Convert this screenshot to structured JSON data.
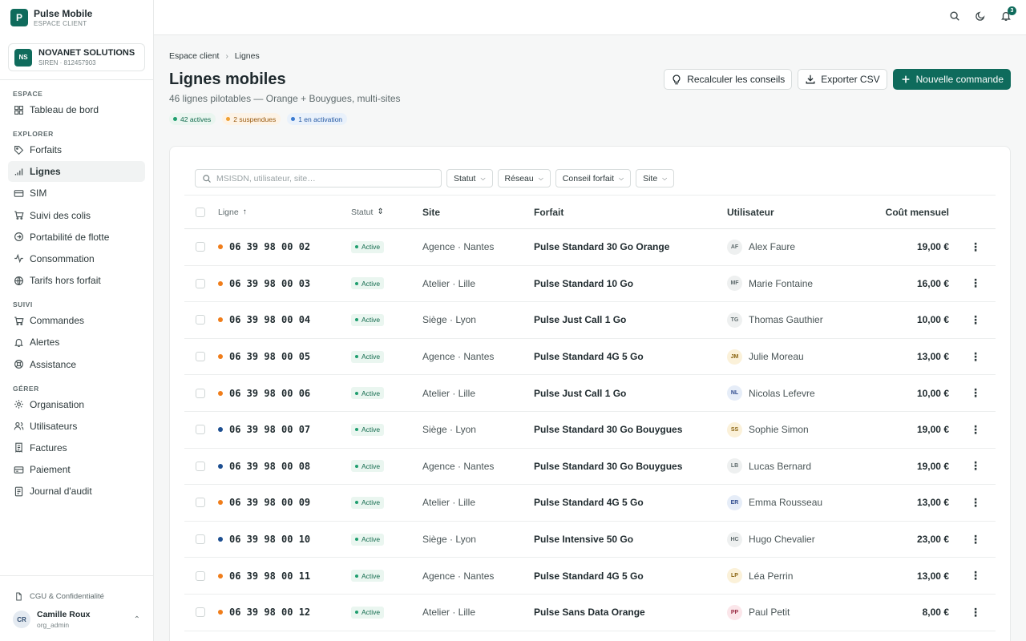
{
  "brand": {
    "logo": "P",
    "name": "Pulse Mobile",
    "sub": "ESPACE CLIENT"
  },
  "org": {
    "badge": "NS",
    "name": "NOVANET SOLUTIONS",
    "siren": "SIREN · 812457903"
  },
  "sidebar": {
    "sections": [
      {
        "label": "ESPACE",
        "items": [
          {
            "label": "Tableau de bord",
            "icon": "dashboard-icon"
          }
        ]
      },
      {
        "label": "EXPLORER",
        "items": [
          {
            "label": "Forfaits",
            "icon": "tag-icon"
          },
          {
            "label": "Lignes",
            "icon": "signal-icon",
            "active": true
          },
          {
            "label": "SIM",
            "icon": "card-icon"
          },
          {
            "label": "Suivi des colis",
            "icon": "truck-icon"
          },
          {
            "label": "Portabilité de flotte",
            "icon": "arrow-circle-icon"
          },
          {
            "label": "Consommation",
            "icon": "activity-icon"
          },
          {
            "label": "Tarifs hors forfait",
            "icon": "globe-icon"
          }
        ]
      },
      {
        "label": "SUIVI",
        "items": [
          {
            "label": "Commandes",
            "icon": "cart-icon"
          },
          {
            "label": "Alertes",
            "icon": "bell-icon"
          },
          {
            "label": "Assistance",
            "icon": "lifebuoy-icon"
          }
        ]
      },
      {
        "label": "GÉRER",
        "items": [
          {
            "label": "Organisation",
            "icon": "settings-icon"
          },
          {
            "label": "Utilisateurs",
            "icon": "users-icon"
          },
          {
            "label": "Factures",
            "icon": "receipt-icon"
          },
          {
            "label": "Paiement",
            "icon": "credit-card-icon"
          },
          {
            "label": "Journal d'audit",
            "icon": "audit-icon"
          }
        ]
      }
    ],
    "legal": "CGU & Confidentialité",
    "user": {
      "initials": "CR",
      "name": "Camille Roux",
      "role": "org_admin"
    }
  },
  "topbar": {
    "notif_count": "3"
  },
  "breadcrumb": {
    "root": "Espace client",
    "current": "Lignes"
  },
  "page": {
    "title": "Lignes mobiles",
    "subtitle": "46 lignes pilotables — Orange + Bouygues, multi-sites",
    "chips": {
      "active": "42 actives",
      "suspended": "2 suspendues",
      "activating": "1 en activation"
    }
  },
  "actions": {
    "recalc": "Recalculer les conseils",
    "export": "Exporter CSV",
    "new_order": "Nouvelle commande"
  },
  "filters": {
    "search_placeholder": "MSISDN, utilisateur, site…",
    "statut": "Statut",
    "reseau": "Réseau",
    "conseil": "Conseil forfait",
    "site": "Site"
  },
  "table": {
    "headers": {
      "ligne": "Ligne",
      "statut": "Statut",
      "site": "Site",
      "forfait": "Forfait",
      "utilisateur": "Utilisateur",
      "cout": "Coût mensuel"
    },
    "colors": {
      "orange": "#f07d1a",
      "bouygues": "#1d4f91"
    },
    "rows": [
      {
        "msisdn": "06 39 98 00 02",
        "network": "orange",
        "status": "Active",
        "site": "Agence · Nantes",
        "forfait": "Pulse Standard 30 Go Orange",
        "initials": "AF",
        "user": "Alex Faure",
        "cout": "19,00 €",
        "av_bg": "#eef0f0",
        "av_fg": "#5f6b6d"
      },
      {
        "msisdn": "06 39 98 00 03",
        "network": "orange",
        "status": "Active",
        "site": "Atelier · Lille",
        "forfait": "Pulse Standard 10 Go",
        "initials": "MF",
        "user": "Marie Fontaine",
        "cout": "16,00 €",
        "av_bg": "#eef0f0",
        "av_fg": "#5f6b6d"
      },
      {
        "msisdn": "06 39 98 00 04",
        "network": "orange",
        "status": "Active",
        "site": "Siège · Lyon",
        "forfait": "Pulse Just Call 1 Go",
        "initials": "TG",
        "user": "Thomas Gauthier",
        "cout": "10,00 €",
        "av_bg": "#eef0f0",
        "av_fg": "#5f6b6d"
      },
      {
        "msisdn": "06 39 98 00 05",
        "network": "orange",
        "status": "Active",
        "site": "Agence · Nantes",
        "forfait": "Pulse Standard 4G 5 Go",
        "initials": "JM",
        "user": "Julie Moreau",
        "cout": "13,00 €",
        "av_bg": "#fbf1d9",
        "av_fg": "#8a6412"
      },
      {
        "msisdn": "06 39 98 00 06",
        "network": "orange",
        "status": "Active",
        "site": "Atelier · Lille",
        "forfait": "Pulse Just Call 1 Go",
        "initials": "NL",
        "user": "Nicolas Lefevre",
        "cout": "10,00 €",
        "av_bg": "#e6edf8",
        "av_fg": "#2f4b8e"
      },
      {
        "msisdn": "06 39 98 00 07",
        "network": "bouygues",
        "status": "Active",
        "site": "Siège · Lyon",
        "forfait": "Pulse Standard 30 Go Bouygues",
        "initials": "SS",
        "user": "Sophie Simon",
        "cout": "19,00 €",
        "av_bg": "#fbf1d9",
        "av_fg": "#8a6412"
      },
      {
        "msisdn": "06 39 98 00 08",
        "network": "bouygues",
        "status": "Active",
        "site": "Agence · Nantes",
        "forfait": "Pulse Standard 30 Go Bouygues",
        "initials": "LB",
        "user": "Lucas Bernard",
        "cout": "19,00 €",
        "av_bg": "#eef0f0",
        "av_fg": "#5f6b6d"
      },
      {
        "msisdn": "06 39 98 00 09",
        "network": "orange",
        "status": "Active",
        "site": "Atelier · Lille",
        "forfait": "Pulse Standard 4G 5 Go",
        "initials": "ER",
        "user": "Emma Rousseau",
        "cout": "13,00 €",
        "av_bg": "#e6edf8",
        "av_fg": "#2f4b8e"
      },
      {
        "msisdn": "06 39 98 00 10",
        "network": "bouygues",
        "status": "Active",
        "site": "Siège · Lyon",
        "forfait": "Pulse Intensive 50 Go",
        "initials": "HC",
        "user": "Hugo Chevalier",
        "cout": "23,00 €",
        "av_bg": "#eef0f0",
        "av_fg": "#5f6b6d"
      },
      {
        "msisdn": "06 39 98 00 11",
        "network": "orange",
        "status": "Active",
        "site": "Agence · Nantes",
        "forfait": "Pulse Standard 4G 5 Go",
        "initials": "LP",
        "user": "Léa Perrin",
        "cout": "13,00 €",
        "av_bg": "#fbf1d9",
        "av_fg": "#8a6412"
      },
      {
        "msisdn": "06 39 98 00 12",
        "network": "orange",
        "status": "Active",
        "site": "Atelier · Lille",
        "forfait": "Pulse Sans Data Orange",
        "initials": "PP",
        "user": "Paul Petit",
        "cout": "8,00 €",
        "av_bg": "#fbe6ea",
        "av_fg": "#9a2d45"
      }
    ]
  }
}
